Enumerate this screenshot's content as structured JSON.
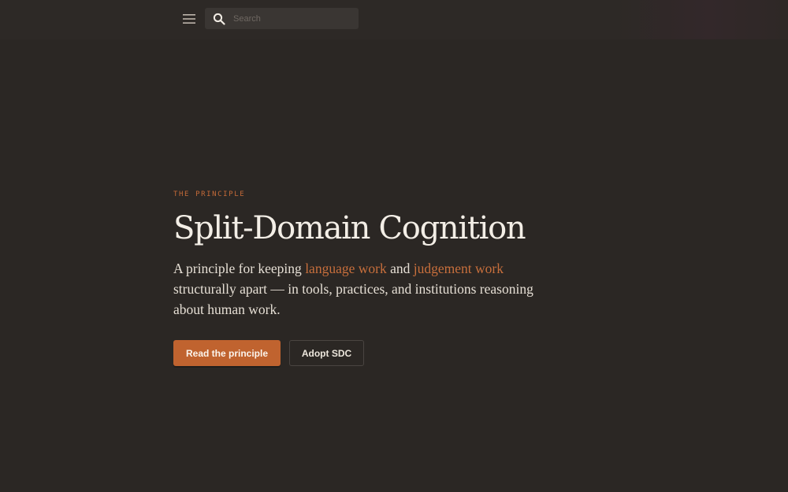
{
  "header": {
    "menu_icon": "hamburger-menu-icon",
    "search": {
      "icon": "search-icon",
      "placeholder": "Search",
      "value": ""
    }
  },
  "hero": {
    "eyebrow": "THE PRINCIPLE",
    "title": "Split-Domain Cognition",
    "description": {
      "part1": "A principle for keeping ",
      "highlight1": "language work",
      "part2": " and ",
      "highlight2": "judgement work",
      "part3": " structurally apart — in tools, practices, and institutions reasoning about human work."
    },
    "primary_button": "Read the principle",
    "secondary_button": "Adopt SDC"
  },
  "colors": {
    "background": "#2b2724",
    "accent": "#c0632f",
    "text": "#ece6dc"
  }
}
